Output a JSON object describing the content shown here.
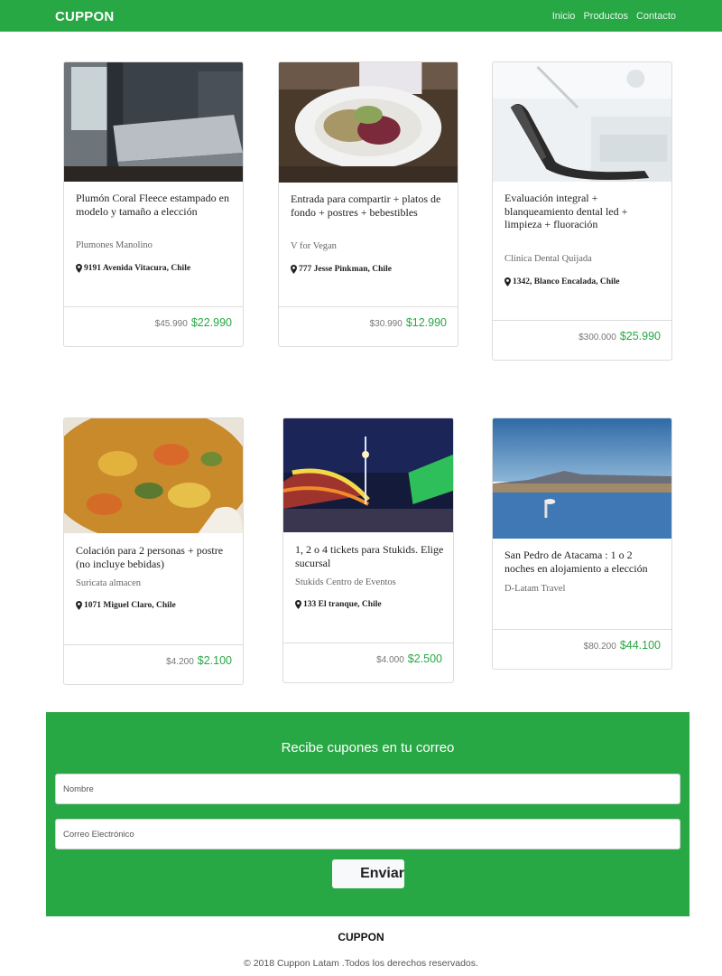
{
  "nav": {
    "brand": "CUPPON",
    "links": [
      "Inicio",
      "Productos",
      "Contacto"
    ]
  },
  "cards": [
    {
      "image": "bedroom-photo",
      "title": "Plumón Coral Fleece estampado en modelo y tamaño a elección",
      "merchant": "Plumones Manolino",
      "address": "9191 Avenida Vitacura, Chile",
      "old_price": "$45.990",
      "new_price": "$22.990"
    },
    {
      "image": "salad-photo",
      "title": "Entrada para compartir + platos de fondo + postres + bebestibles",
      "merchant": "V for Vegan",
      "address": "777 Jesse Pinkman, Chile",
      "old_price": "$30.990",
      "new_price": "$12.990"
    },
    {
      "image": "dental-chair-photo",
      "title": "Evaluación integral + blanqueamiento dental led + limpieza + fluoración",
      "merchant": "Clínica Dental Quijada",
      "address": "1342, Blanco Encalada, Chile",
      "old_price": "$300.000",
      "new_price": "$25.990"
    },
    {
      "image": "food-dish-photo",
      "title": "Colación para 2 personas + postre (no incluye bebidas)",
      "merchant": "Suricata almacen",
      "address": "1071 Miguel Claro, Chile",
      "old_price": "$4.200",
      "new_price": "$2.100"
    },
    {
      "image": "amusement-park-photo",
      "title": "1, 2 o 4 tickets para Stukids. Elige sucursal",
      "merchant": "Stukids Centro de Eventos",
      "address": "133 El tranque, Chile",
      "old_price": "$4.000",
      "new_price": "$2.500"
    },
    {
      "image": "atacama-lagoon-photo",
      "title": "San Pedro de Atacama : 1 o 2 noches en alojamiento a elección",
      "merchant": "D-Latam Travel",
      "address": "",
      "old_price": "$80.200",
      "new_price": "$44.100"
    }
  ],
  "subscribe": {
    "title": "Recibe cupones en tu correo",
    "name_placeholder": "Nombre",
    "email_placeholder": "Correo Electrónico",
    "button_label": "Enviar"
  },
  "footer": {
    "brand": "CUPPON",
    "copyright": "© 2018 Cuppon Latam .Todos los derechos reservados."
  },
  "colors": {
    "accent": "#28a745",
    "price": "#28a745"
  }
}
